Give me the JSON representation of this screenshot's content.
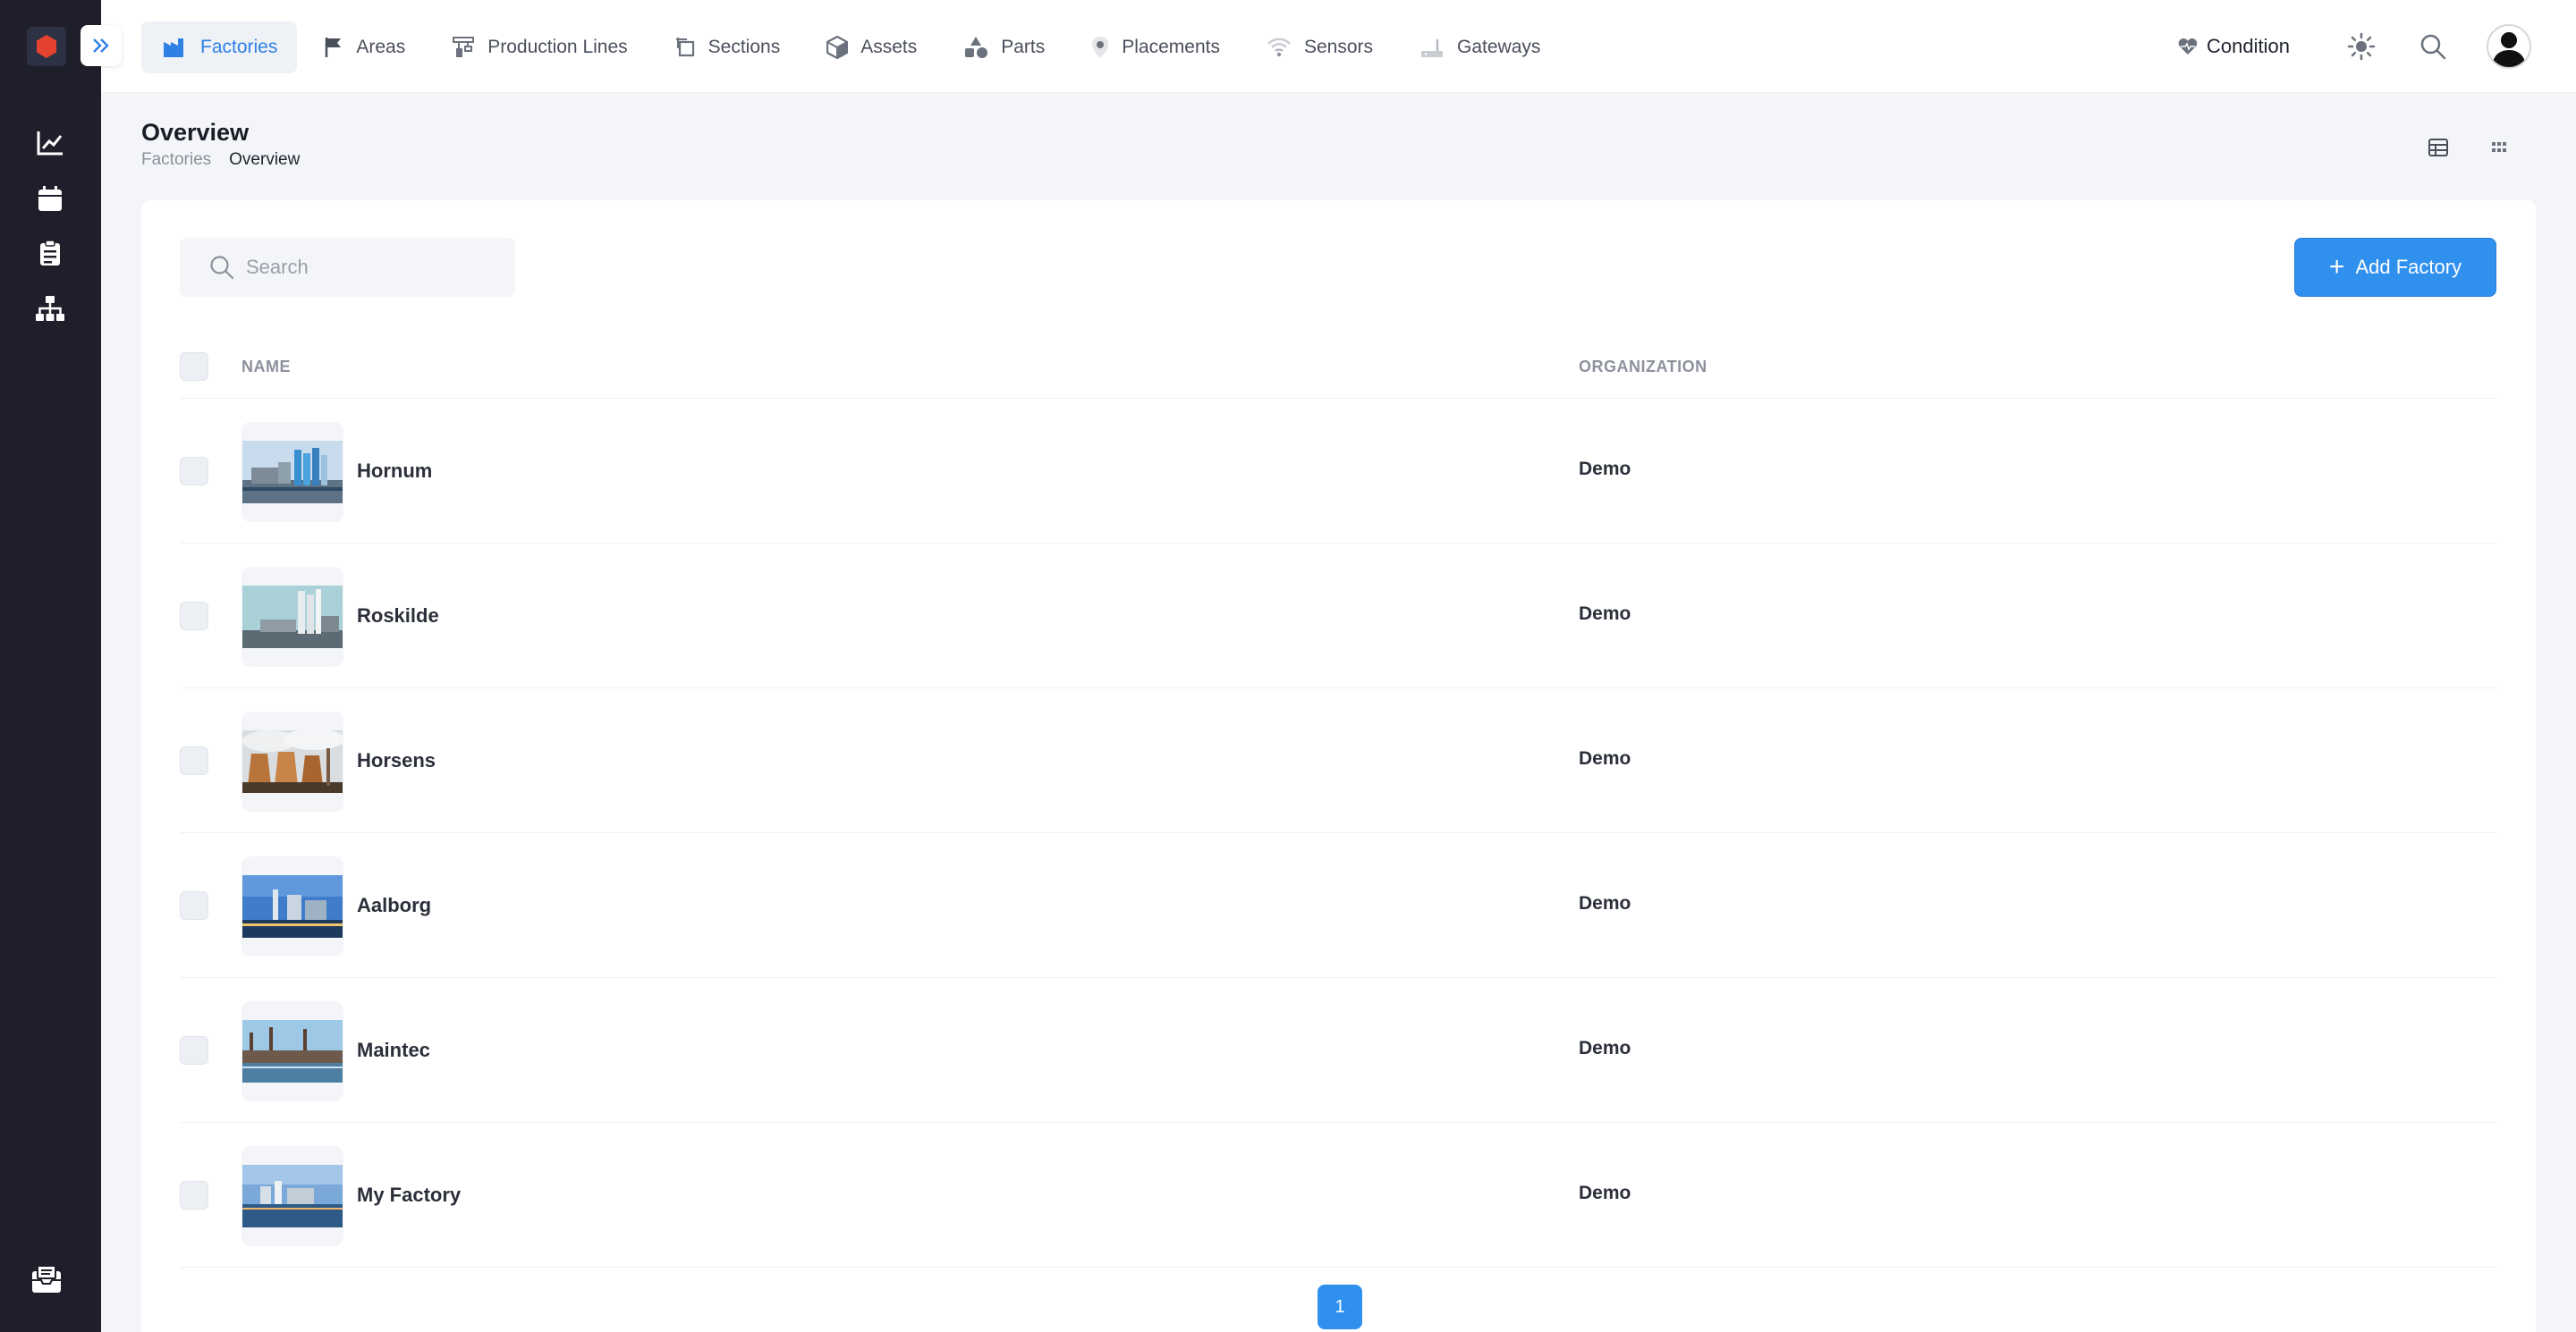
{
  "nav": {
    "items": [
      {
        "label": "Factories",
        "icon": "factory-icon",
        "active": true
      },
      {
        "label": "Areas",
        "icon": "flag-icon"
      },
      {
        "label": "Production Lines",
        "icon": "production-line-icon"
      },
      {
        "label": "Sections",
        "icon": "section-icon"
      },
      {
        "label": "Assets",
        "icon": "cube-icon"
      },
      {
        "label": "Parts",
        "icon": "shapes-icon"
      },
      {
        "label": "Placements",
        "icon": "map-pin-icon"
      },
      {
        "label": "Sensors",
        "icon": "wifi-icon"
      },
      {
        "label": "Gateways",
        "icon": "router-icon"
      }
    ],
    "condition_label": "Condition"
  },
  "sidebar": {
    "items": [
      {
        "icon": "chart-line-icon"
      },
      {
        "icon": "calendar-icon"
      },
      {
        "icon": "clipboard-icon"
      },
      {
        "icon": "hierarchy-icon"
      }
    ],
    "bottom_icon": "inbox-icon"
  },
  "page": {
    "title": "Overview",
    "breadcrumb": [
      "Factories",
      "Overview"
    ]
  },
  "search": {
    "placeholder": "Search",
    "value": ""
  },
  "add_button": {
    "label": "Add Factory"
  },
  "table": {
    "columns": [
      "NAME",
      "ORGANIZATION"
    ],
    "rows": [
      {
        "name": "Hornum",
        "organization": "Demo"
      },
      {
        "name": "Roskilde",
        "organization": "Demo"
      },
      {
        "name": "Horsens",
        "organization": "Demo"
      },
      {
        "name": "Aalborg",
        "organization": "Demo"
      },
      {
        "name": "Maintec",
        "organization": "Demo"
      },
      {
        "name": "My Factory",
        "organization": "Demo"
      }
    ]
  },
  "pagination": {
    "current": "1"
  },
  "colors": {
    "accent": "#2f90ee",
    "sidebar": "#1e1f2a",
    "logo": "#e5432f"
  }
}
